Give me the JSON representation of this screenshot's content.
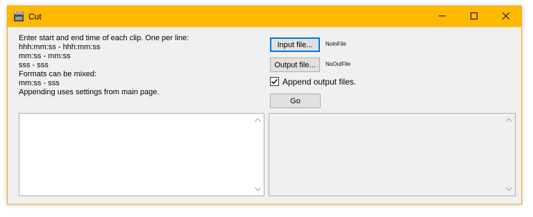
{
  "window": {
    "title": "Cut",
    "title_bar_color": "#ffb900"
  },
  "instructions": {
    "lines": [
      "Enter start and end time of each clip. One per line:",
      "hhh:mm:ss - hhh:mm:ss",
      "mm:ss - mm:ss",
      "sss - sss",
      "Formats can be mixed:",
      "mm:ss - sss",
      "Appending uses settings from main page."
    ]
  },
  "buttons": {
    "input_file": "Input file...",
    "output_file": "Output file...",
    "go": "Go"
  },
  "labels": {
    "input_file_value": "NoInFile",
    "output_file_value": "NoOutFile"
  },
  "append": {
    "label": "Append output files.",
    "checked": true
  },
  "clips_textarea": {
    "value": ""
  },
  "output_textarea": {
    "value": ""
  },
  "icons": {
    "app": "film-clapper-icon",
    "minimize": "minimize-icon",
    "maximize": "maximize-icon",
    "close": "close-icon"
  }
}
